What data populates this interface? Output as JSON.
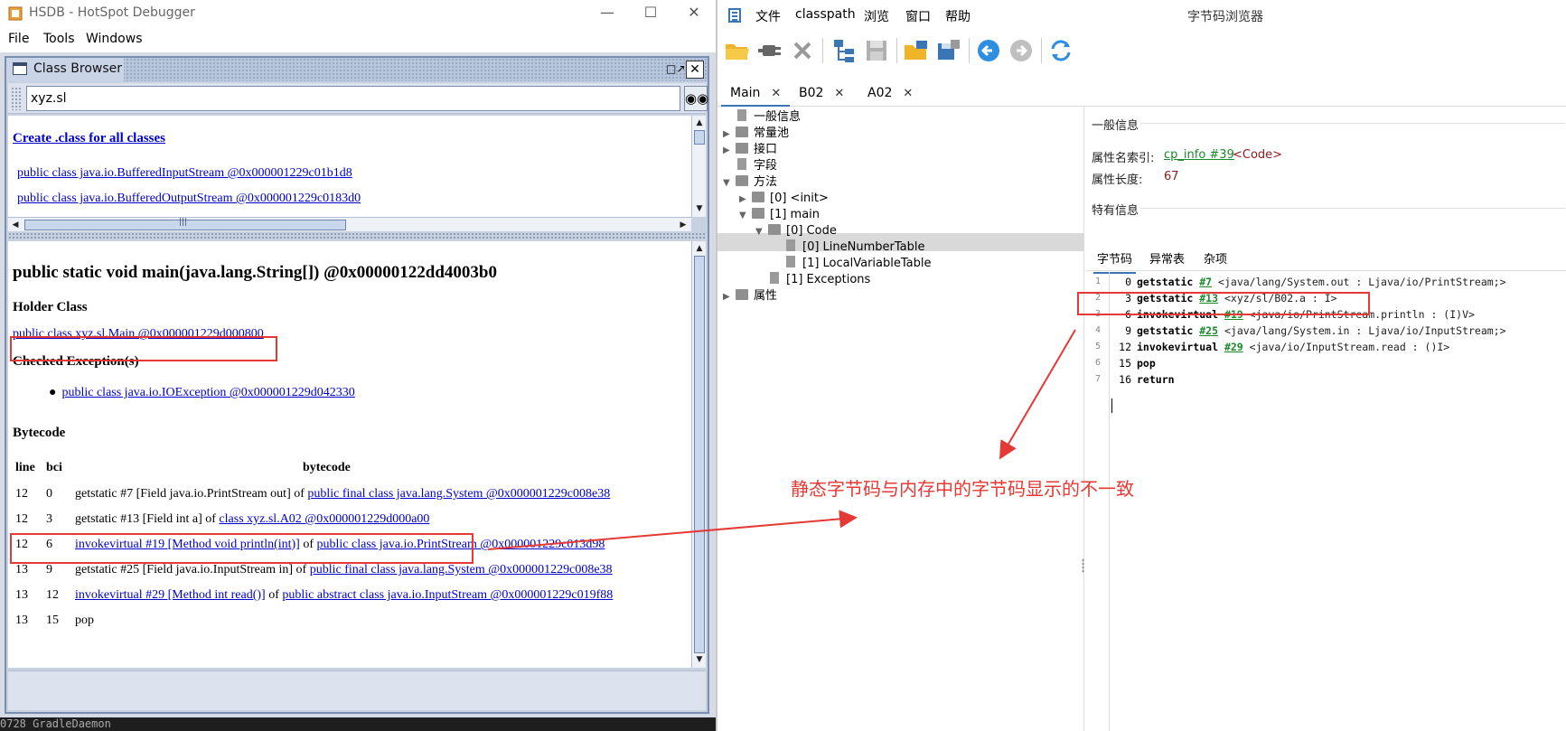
{
  "hsdb": {
    "window_title": "HSDB - HotSpot Debugger",
    "menu": {
      "file": "File",
      "tools": "Tools",
      "windows": "Windows"
    },
    "class_browser": {
      "title": "Class Browser",
      "search_value": "xyz.sl",
      "create_link": "Create .class for all classes",
      "class_items": [
        "public class java.io.BufferedInputStream @0x000001229c01b1d8",
        "public class java.io.BufferedOutputStream @0x000001229c0183d0"
      ],
      "method_signature": "public static void main(java.lang.String[]) @0x00000122dd4003b0",
      "holder_class_heading": "Holder Class",
      "holder_class_link": "public class xyz.sl.Main @0x000001229d000800",
      "checked_exceptions_heading": "Checked Exception(s)",
      "exception_link": "public class java.io.IOException @0x000001229d042330",
      "bytecode_heading": "Bytecode",
      "bytecode_columns": {
        "line": "line",
        "bci": "bci",
        "bytecode": "bytecode"
      },
      "bytecode_rows": [
        {
          "line": "12",
          "bci": "0",
          "plain": "getstatic #7 [Field java.io.PrintStream out] of ",
          "link": "public final class java.lang.System @0x000001229c008e38"
        },
        {
          "line": "12",
          "bci": "3",
          "plain": "getstatic #13 [Field int a] of ",
          "link": "class xyz.sl.A02 @0x000001229d000a00"
        },
        {
          "line": "12",
          "bci": "6",
          "link0": "invokevirtual #19 [Method void println(int)]",
          "plain": " of ",
          "link": "public class java.io.PrintStream @0x000001229c013d98"
        },
        {
          "line": "13",
          "bci": "9",
          "plain": "getstatic #25 [Field java.io.InputStream in] of ",
          "link": "public final class java.lang.System @0x000001229c008e38"
        },
        {
          "line": "13",
          "bci": "12",
          "link0": "invokevirtual #29 [Method int read()]",
          "plain": " of ",
          "link": "public abstract class java.io.InputStream @0x000001229c019f88"
        },
        {
          "line": "13",
          "bci": "15",
          "plain": "pop"
        }
      ]
    },
    "console_text": "0728 GradleDaemon"
  },
  "jclasslib": {
    "menu": {
      "file": "文件",
      "classpath": "classpath",
      "browse": "浏览",
      "window": "窗口",
      "help": "帮助"
    },
    "window_title": "字节码浏览器",
    "file_tabs": [
      "Main",
      "B02",
      "A02"
    ],
    "tree": {
      "general": "一般信息",
      "constant_pool": "常量池",
      "interfaces": "接口",
      "fields": "字段",
      "methods": "方法",
      "init": "[0] <init>",
      "main": "[1] main",
      "code": "[0] Code",
      "line_number_table": "[0] LineNumberTable",
      "local_variable_table": "[1] LocalVariableTable",
      "exceptions": "[1] Exceptions",
      "attributes": "属性"
    },
    "detail": {
      "general_heading": "一般信息",
      "attr_name_index_label": "属性名索引:",
      "attr_name_index_link": "cp_info #39",
      "attr_name_index_value": "<Code>",
      "attr_length_label": "属性长度:",
      "attr_length_value": "67",
      "specific_heading": "特有信息",
      "sub_tabs": [
        "字节码",
        "异常表",
        "杂项"
      ]
    },
    "code_lines": [
      {
        "n": "1",
        "off": "0",
        "op": "getstatic",
        "ref": "#7",
        "arg": "<java/lang/System.out : Ljava/io/PrintStream;>"
      },
      {
        "n": "2",
        "off": "3",
        "op": "getstatic",
        "ref": "#13",
        "arg": "<xyz/sl/B02.a : I>"
      },
      {
        "n": "3",
        "off": "6",
        "op": "invokevirtual",
        "ref": "#19",
        "arg": "<java/io/PrintStream.println : (I)V>"
      },
      {
        "n": "4",
        "off": "9",
        "op": "getstatic",
        "ref": "#25",
        "arg": "<java/lang/System.in : Ljava/io/InputStream;>"
      },
      {
        "n": "5",
        "off": "12",
        "op": "invokevirtual",
        "ref": "#29",
        "arg": "<java/io/InputStream.read : ()I>"
      },
      {
        "n": "6",
        "off": "15",
        "op": "pop",
        "ref": "",
        "arg": ""
      },
      {
        "n": "7",
        "off": "16",
        "op": "return",
        "ref": "",
        "arg": ""
      }
    ]
  },
  "annotation": "静态字节码与内存中的字节码显示的不一致",
  "colors": {
    "annotation_red": "#e53935",
    "link_blue": "#0000cc",
    "cp_green": "#1a8a2a",
    "value_maroon": "#8b1a1a"
  }
}
